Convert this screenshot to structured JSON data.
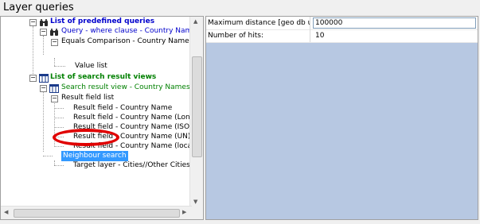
{
  "panel_title": "Layer queries",
  "tree": {
    "nodes": [
      {
        "label": "List of predefined queries"
      },
      {
        "label": "Query - where clause - Country Names"
      },
      {
        "label": "Equals Comparison - Country Name - Ba"
      },
      {
        "label": "Value list"
      },
      {
        "label": "List of search result views"
      },
      {
        "label": "Search result view - Country Names"
      },
      {
        "label": "Result field list"
      },
      {
        "label": "Result field - Country Name"
      },
      {
        "label": "Result field - Country Name (Long)"
      },
      {
        "label": "Result field - Country Name (ISO)"
      },
      {
        "label": "Result field - Country Name (UN)"
      },
      {
        "label": "Result field - Country Name (local)"
      },
      {
        "label": "Neighbour search"
      },
      {
        "label": "Target layer - Cities//Other Cities - W"
      }
    ],
    "expand_glyph": "−"
  },
  "properties": [
    {
      "label": "Maximum distance [geo db units]:",
      "value": "100000"
    },
    {
      "label": "Number of hits:",
      "value": "10"
    }
  ],
  "icons": {
    "binoculars": "binoculars-icon",
    "table": "table-icon"
  },
  "colors": {
    "selection": "#3399ff",
    "highlight_ellipse": "#e00000",
    "pane_background": "#b7c8e2"
  }
}
